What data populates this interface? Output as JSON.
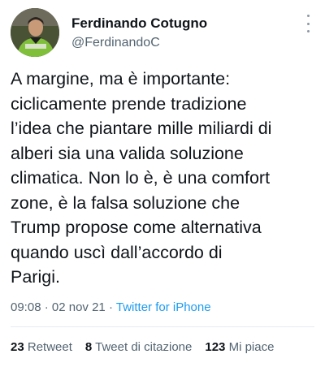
{
  "author": {
    "display_name": "Ferdinando Cotugno",
    "handle": "@FerdinandoC"
  },
  "tweet": {
    "text": "A margine, ma è importante:\nciclicamente prende tradizione\nl’idea che piantare mille miliardi di\nalberi sia una valida soluzione\nclimatica. Non lo è, è una comfort\nzone, è la falsa soluzione che\nTrump propose come alternativa\nquando uscì dall’accordo di\nParigi."
  },
  "meta": {
    "time": "09:08",
    "date": "02 nov 21",
    "separator": "·",
    "source": "Twitter for iPhone"
  },
  "stats": {
    "retweets_count": "23",
    "retweets_label": "Retweet",
    "quotes_count": "8",
    "quotes_label": "Tweet di citazione",
    "likes_count": "123",
    "likes_label": "Mi piace"
  },
  "colors": {
    "text_primary": "#0f1419",
    "text_secondary": "#536471",
    "link": "#1d9bf0",
    "divider": "#e6ecf0"
  },
  "icons": {
    "more": "more-options-icon"
  }
}
